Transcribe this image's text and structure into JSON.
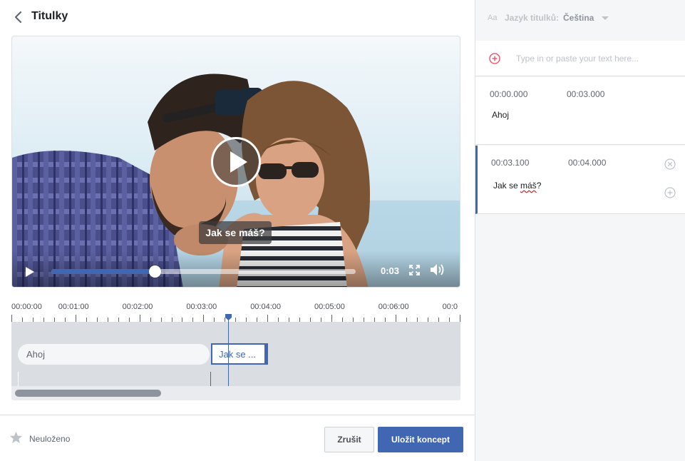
{
  "header": {
    "title": "Titulky"
  },
  "video": {
    "caption_overlay": "Jak se máš?",
    "current_time": "0:03",
    "progress_fraction": 0.34
  },
  "timeline": {
    "tick_labels": [
      "00:00:00",
      "00:01:00",
      "00:02:00",
      "00:03:00",
      "00:04:00",
      "00:05:00",
      "00:06:00",
      "00:0"
    ],
    "clips": [
      {
        "text": "Ahoj"
      },
      {
        "text": "Jak se ..."
      }
    ]
  },
  "footer": {
    "status": "Neuloženo",
    "cancel_label": "Zrušit",
    "save_label": "Uložit koncept"
  },
  "sidebar": {
    "lang_icon": "Aa",
    "lang_label": "Jazyk titulků:",
    "lang_value": "Čeština",
    "input_placeholder": "Type in or paste your text here...",
    "cues": [
      {
        "start": "00:00.000",
        "end": "00:03.000",
        "text": "Ahoj"
      },
      {
        "start": "00:03.100",
        "end": "00:04.000",
        "text_before": "Jak se ",
        "text_misspelled": "máš",
        "text_after": "?"
      }
    ]
  },
  "colors": {
    "accent": "#4267b2",
    "add_red": "#f3425f"
  }
}
